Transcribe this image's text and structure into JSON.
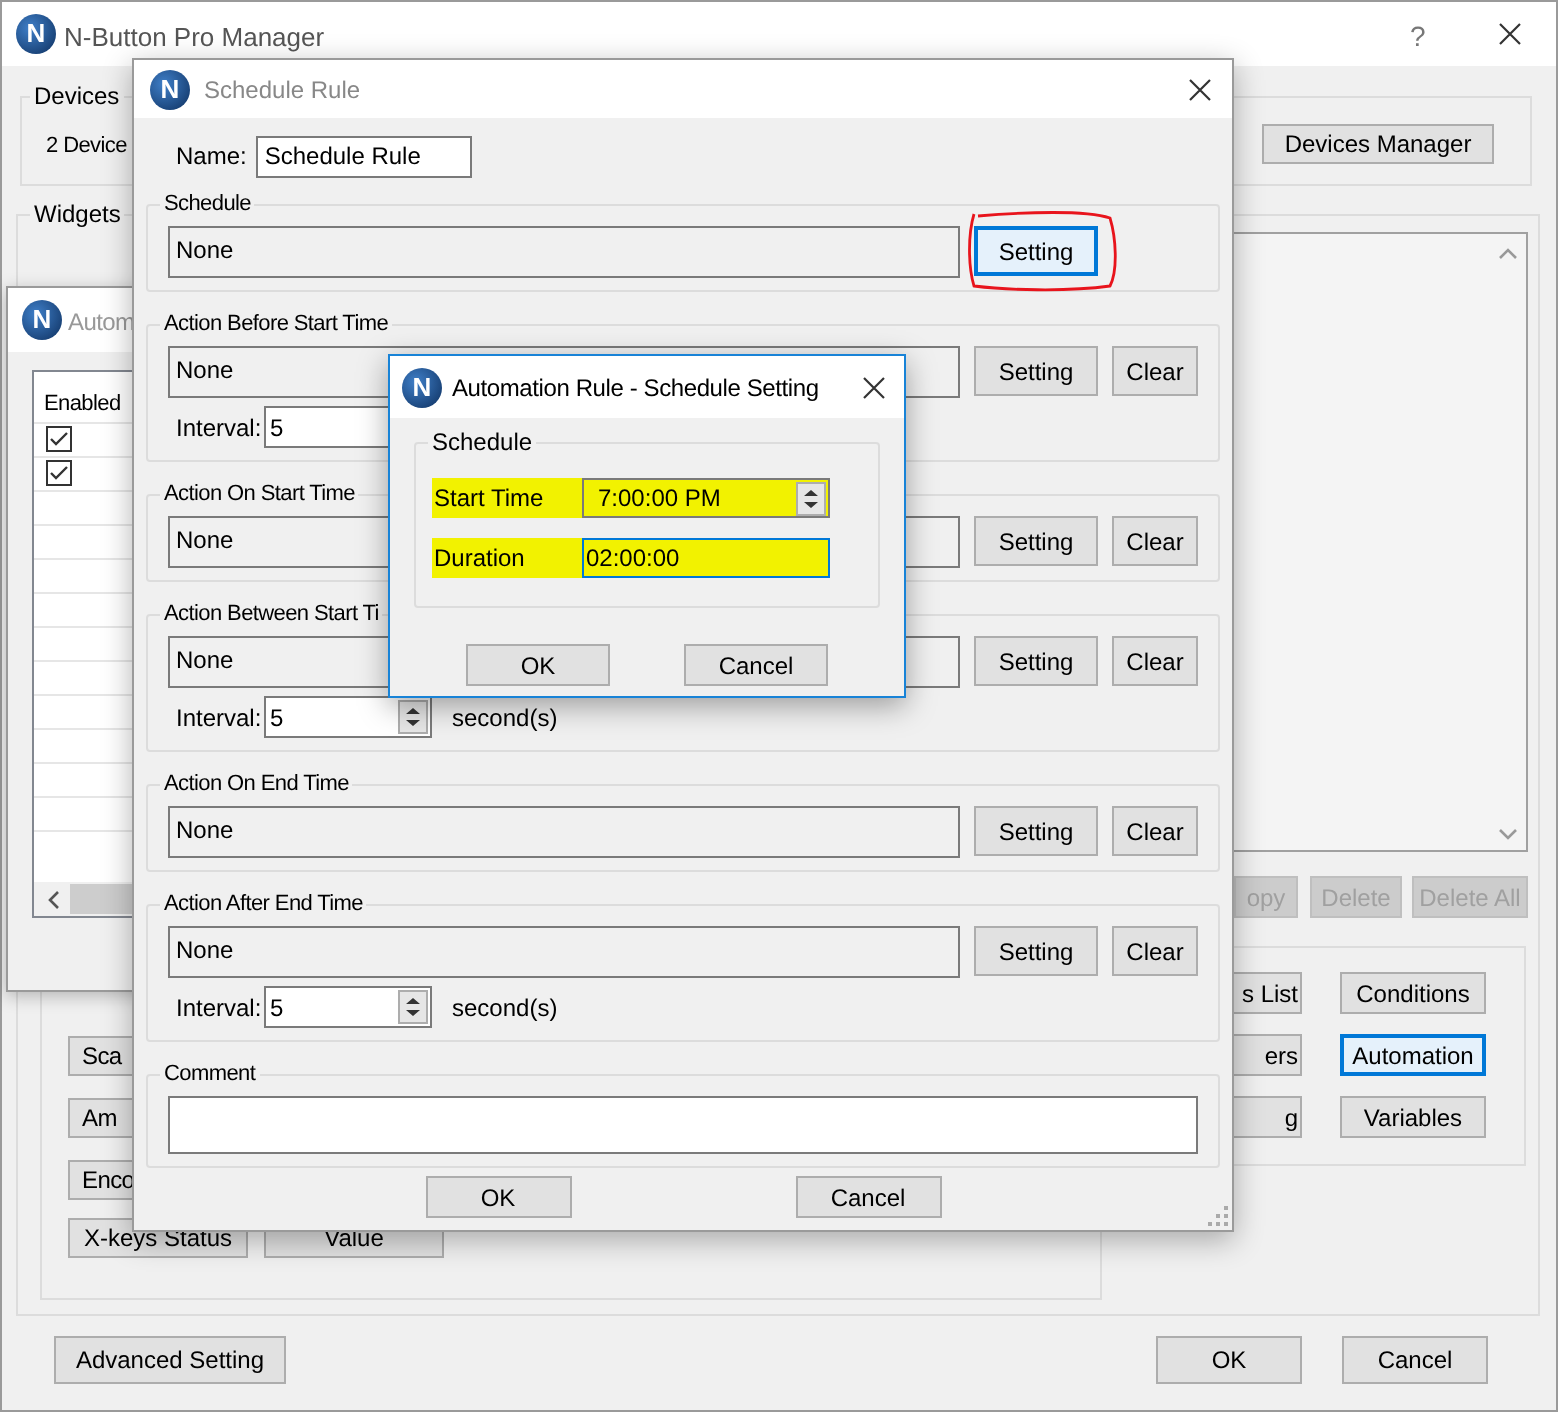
{
  "main_window": {
    "icon_letter": "N",
    "title": "N-Button Pro Manager",
    "help": "?",
    "devices": {
      "label": "Devices",
      "summary": "2 Device",
      "button": "Devices Manager"
    },
    "widgets": {
      "label": "Widgets",
      "list_buttons": [
        {
          "label": "opy",
          "disabled": true
        },
        {
          "label": "Delete",
          "disabled": true
        },
        {
          "label": "Delete All",
          "disabled": true
        }
      ],
      "left_buttons": [
        "Sca",
        "Am",
        "Enco"
      ],
      "status_buttons": [
        "X-keys Status",
        "Value"
      ],
      "right_buttons": [
        {
          "label": "s List",
          "focused": false
        },
        {
          "label": "Conditions",
          "focused": false
        },
        {
          "label": "ers",
          "focused": false
        },
        {
          "label": "Automation",
          "focused": true
        },
        {
          "label": "g",
          "focused": false
        },
        {
          "label": "Variables",
          "focused": false
        }
      ]
    },
    "advanced_button": "Advanced Setting",
    "ok_button": "OK",
    "cancel_button": "Cancel"
  },
  "automation_window": {
    "icon_letter": "N",
    "title": "Autom",
    "column": "Enabled",
    "rows": [
      {
        "checked": true
      },
      {
        "checked": true
      }
    ]
  },
  "schedule_rule": {
    "icon_letter": "N",
    "title": "Schedule Rule",
    "name_label": "Name:",
    "name": "Schedule Rule",
    "sections": [
      {
        "kind": "action",
        "title": "Schedule",
        "value": "None",
        "buttons": [
          {
            "label": "Setting",
            "focused": true,
            "circled": true
          }
        ]
      },
      {
        "kind": "action",
        "title": "Action Before Start Time",
        "value": "None",
        "buttons": [
          {
            "label": "Setting",
            "focused": false,
            "circled": false
          },
          {
            "label": "Clear",
            "focused": false,
            "circled": false
          }
        ],
        "interval": {
          "label": "Interval:",
          "value": "5"
        }
      },
      {
        "kind": "action",
        "title": "Action On Start Time",
        "value": "None",
        "buttons": [
          {
            "label": "Setting",
            "focused": false,
            "circled": false
          },
          {
            "label": "Clear",
            "focused": false,
            "circled": false
          }
        ]
      },
      {
        "kind": "action",
        "title": "Action Between Start Ti",
        "value": "None",
        "buttons": [
          {
            "label": "Setting",
            "focused": false,
            "circled": false
          },
          {
            "label": "Clear",
            "focused": false,
            "circled": false
          }
        ],
        "interval": {
          "label": "Interval:",
          "value": "5",
          "unit": "second(s)"
        }
      },
      {
        "kind": "action",
        "title": "Action On End Time",
        "value": "None",
        "buttons": [
          {
            "label": "Setting",
            "focused": false,
            "circled": false
          },
          {
            "label": "Clear",
            "focused": false,
            "circled": false
          }
        ]
      },
      {
        "kind": "action",
        "title": "Action After End Time",
        "value": "None",
        "buttons": [
          {
            "label": "Setting",
            "focused": false,
            "circled": false
          },
          {
            "label": "Clear",
            "focused": false,
            "circled": false
          }
        ],
        "interval": {
          "label": "Interval:",
          "value": "5",
          "unit": "second(s)"
        }
      },
      {
        "kind": "comment",
        "title": "Comment"
      }
    ],
    "ok_button": "OK",
    "cancel_button": "Cancel"
  },
  "schedule_setting": {
    "icon_letter": "N",
    "title": "Automation Rule - Schedule Setting",
    "group": "Schedule",
    "fields": [
      {
        "kind": "spinner",
        "label": "Start Time",
        "value": "7:00:00 PM",
        "highlighted": true,
        "focused": false
      },
      {
        "kind": "text",
        "label": "Duration",
        "value": "02:00:00",
        "highlighted": true,
        "focused": true
      }
    ],
    "ok_button": "OK",
    "cancel_button": "Cancel"
  }
}
